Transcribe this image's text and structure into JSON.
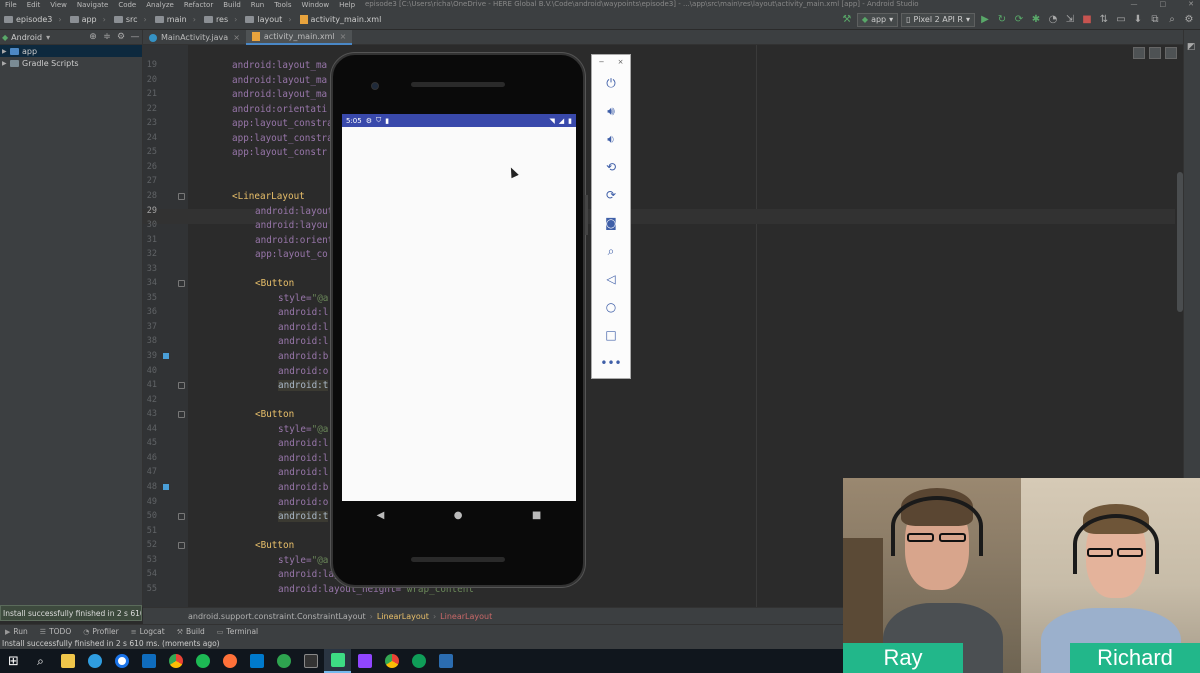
{
  "menu": {
    "items": [
      "File",
      "Edit",
      "View",
      "Navigate",
      "Code",
      "Analyze",
      "Refactor",
      "Build",
      "Run",
      "Tools",
      "Window",
      "Help"
    ],
    "window_title": "episode3 [C:\\Users\\richa\\OneDrive - HERE Global B.V.\\Code\\android\\waypoints\\episode3] - ...\\app\\src\\main\\res\\layout\\activity_main.xml [app] - Android Studio"
  },
  "nav": {
    "breadcrumbs": [
      "episode3",
      "app",
      "src",
      "main",
      "res",
      "layout",
      "activity_main.xml"
    ],
    "run_config": "app",
    "device": "Pixel 2 API R"
  },
  "project": {
    "view_mode": "Android",
    "tree": [
      "app",
      "Gradle Scripts"
    ]
  },
  "tabs": [
    {
      "label": "MainActivity.java"
    },
    {
      "label": "activity_main.xml"
    }
  ],
  "editor": {
    "current_line": 29,
    "lines": [
      {
        "n": 19,
        "parts": [
          [
            "attr",
            "android:layout_ma"
          ]
        ]
      },
      {
        "n": 20,
        "parts": [
          [
            "attr",
            "android:layout_ma"
          ]
        ]
      },
      {
        "n": 21,
        "parts": [
          [
            "attr",
            "android:layout_ma"
          ]
        ]
      },
      {
        "n": 22,
        "parts": [
          [
            "attr",
            "android:orientati"
          ]
        ]
      },
      {
        "n": 23,
        "parts": [
          [
            "attr",
            "app:layout_constra"
          ]
        ]
      },
      {
        "n": 24,
        "parts": [
          [
            "attr",
            "app:layout_constra"
          ]
        ]
      },
      {
        "n": 25,
        "parts": [
          [
            "attr",
            "app:layout_constr"
          ]
        ]
      },
      {
        "n": 26,
        "parts": []
      },
      {
        "n": 27,
        "parts": []
      },
      {
        "n": 28,
        "parts": [
          [
            "tag",
            "<LinearLayout"
          ]
        ],
        "fold": true
      },
      {
        "n": 29,
        "indent": 1,
        "parts": [
          [
            "attr",
            "android:layout"
          ]
        ]
      },
      {
        "n": 30,
        "indent": 1,
        "parts": [
          [
            "attr",
            "android:layou"
          ]
        ]
      },
      {
        "n": 31,
        "indent": 1,
        "parts": [
          [
            "attr",
            "android:orient"
          ]
        ]
      },
      {
        "n": 32,
        "indent": 1,
        "parts": [
          [
            "attr",
            "app:layout_co"
          ]
        ]
      },
      {
        "n": 33,
        "parts": []
      },
      {
        "n": 34,
        "indent": 1,
        "parts": [
          [
            "tag",
            "<Button"
          ]
        ],
        "fold": true
      },
      {
        "n": 35,
        "indent": 2,
        "parts": [
          [
            "attr",
            "style="
          ],
          [
            "str",
            "\"@a"
          ]
        ]
      },
      {
        "n": 36,
        "indent": 2,
        "parts": [
          [
            "attr",
            "android:l"
          ]
        ]
      },
      {
        "n": 37,
        "indent": 2,
        "parts": [
          [
            "attr",
            "android:l"
          ]
        ]
      },
      {
        "n": 38,
        "indent": 2,
        "parts": [
          [
            "attr",
            "android:l"
          ]
        ]
      },
      {
        "n": 39,
        "indent": 2,
        "parts": [
          [
            "attr",
            "android:b"
          ]
        ],
        "marker": true
      },
      {
        "n": 40,
        "indent": 2,
        "parts": [
          [
            "attr",
            "android:o"
          ]
        ]
      },
      {
        "n": 41,
        "indent": 2,
        "parts": [
          [
            "hl",
            "android:t"
          ]
        ],
        "fold": true
      },
      {
        "n": 42,
        "parts": []
      },
      {
        "n": 43,
        "indent": 1,
        "parts": [
          [
            "tag",
            "<Button"
          ]
        ],
        "fold": true
      },
      {
        "n": 44,
        "indent": 2,
        "parts": [
          [
            "attr",
            "style="
          ],
          [
            "str",
            "\"@a"
          ]
        ]
      },
      {
        "n": 45,
        "indent": 2,
        "parts": [
          [
            "attr",
            "android:l"
          ]
        ]
      },
      {
        "n": 46,
        "indent": 2,
        "parts": [
          [
            "attr",
            "android:l"
          ]
        ]
      },
      {
        "n": 47,
        "indent": 2,
        "parts": [
          [
            "attr",
            "android:l"
          ]
        ]
      },
      {
        "n": 48,
        "indent": 2,
        "parts": [
          [
            "attr",
            "android:b"
          ]
        ],
        "marker": true
      },
      {
        "n": 49,
        "indent": 2,
        "parts": [
          [
            "attr",
            "android:o"
          ]
        ]
      },
      {
        "n": 50,
        "indent": 2,
        "parts": [
          [
            "hl",
            "android:t"
          ]
        ],
        "fold": true
      },
      {
        "n": 51,
        "parts": []
      },
      {
        "n": 52,
        "indent": 1,
        "parts": [
          [
            "tag",
            "<Button"
          ]
        ],
        "fold": true
      },
      {
        "n": 53,
        "indent": 2,
        "parts": [
          [
            "attr",
            "style="
          ],
          [
            "str",
            "\"@a"
          ]
        ]
      },
      {
        "n": 54,
        "indent": 2,
        "parts": [
          [
            "attr",
            "android:lay"
          ]
        ]
      },
      {
        "n": 55,
        "indent": 2,
        "parts": [
          [
            "attr",
            "android:layout_height="
          ],
          [
            "str",
            "\"wrap_content\""
          ]
        ]
      }
    ]
  },
  "breadcrumb_bottom": [
    "android.support.constraint.ConstraintLayout",
    "LinearLayout",
    "LinearLayout"
  ],
  "toast": "Install successfully finished in 2 s 610 ms.",
  "toolwindows": [
    "Run",
    "TODO",
    "Profiler",
    "Logcat",
    "Build",
    "Terminal"
  ],
  "status_message": "Install successfully finished in 2 s 610 ms. (moments ago)",
  "emulator": {
    "status_time": "5:05",
    "panel": {
      "min": "−",
      "close": "×"
    },
    "controls": [
      "power-icon",
      "volume-up-icon",
      "volume-down-icon",
      "rotate-left-icon",
      "rotate-right-icon",
      "camera-icon",
      "zoom-icon",
      "back-icon",
      "home-icon",
      "overview-icon",
      "more-icon"
    ]
  },
  "webcams": [
    {
      "name": "Ray"
    },
    {
      "name": "Richard"
    }
  ],
  "colors": {
    "ide_bg": "#2b2b2b",
    "statusbar_phone": "#3949ab",
    "nametag": "#22b78a"
  }
}
